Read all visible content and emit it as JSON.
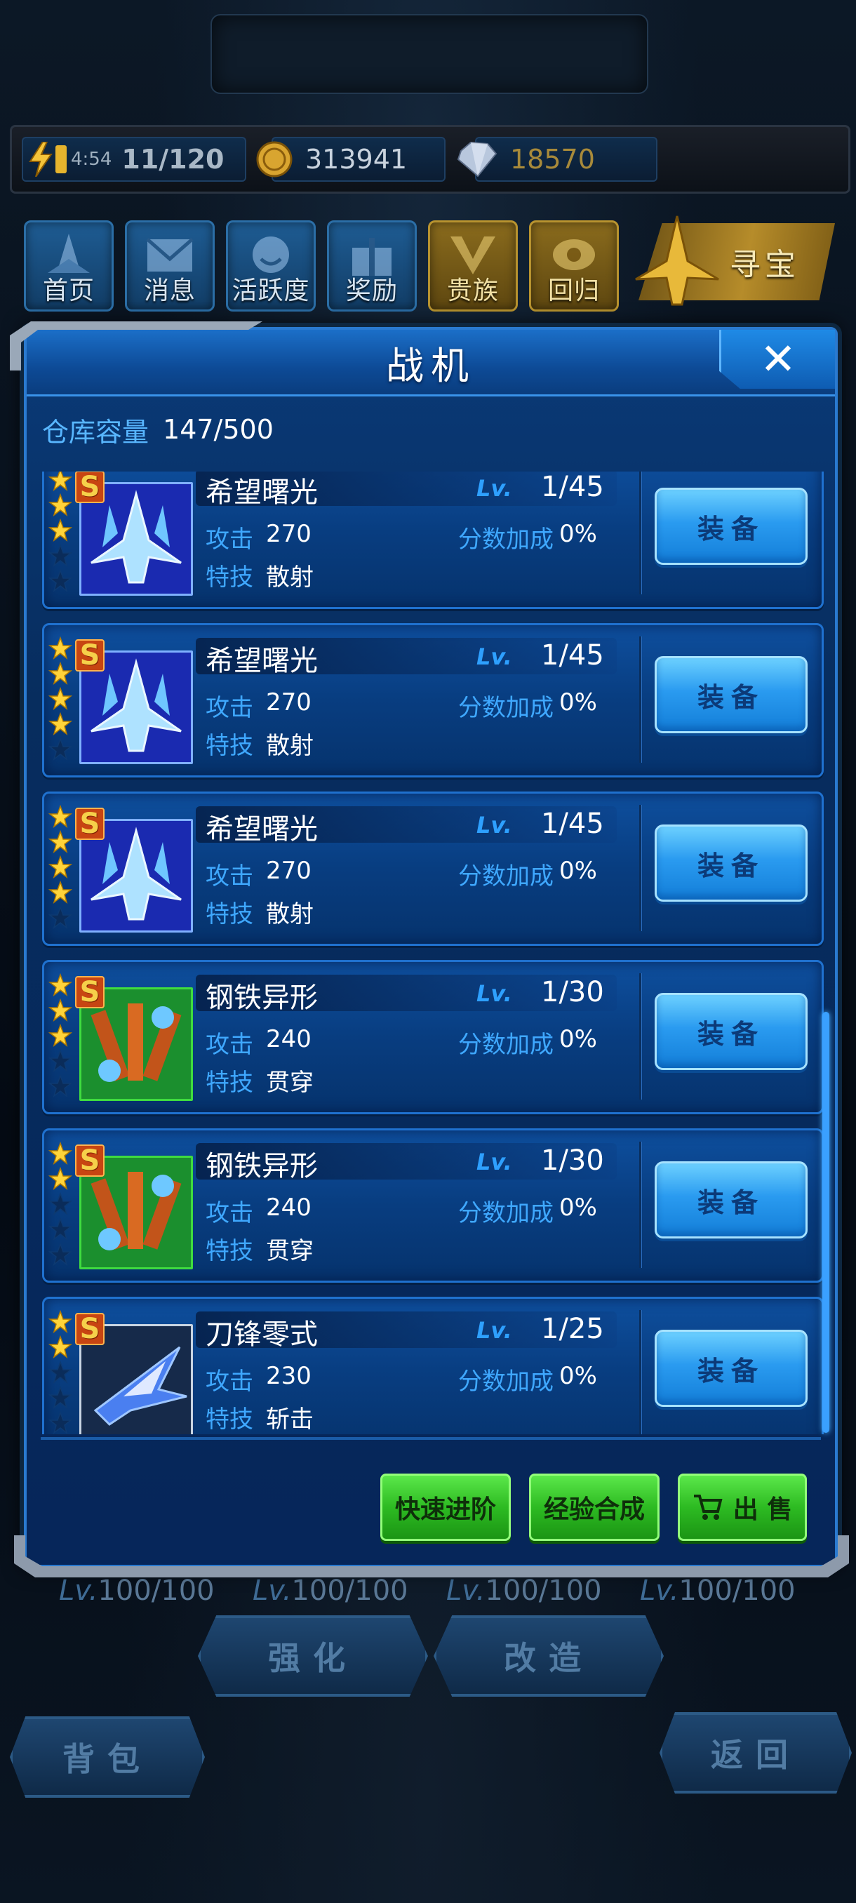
{
  "resources": {
    "energy_timer": "4:54",
    "energy": "11/120",
    "coins": "313941",
    "gems": "18570"
  },
  "nav": [
    {
      "label": "首页"
    },
    {
      "label": "消息"
    },
    {
      "label": "活跃度"
    },
    {
      "label": "奖励"
    },
    {
      "label": "贵族"
    },
    {
      "label": "回归"
    },
    {
      "label": "寻宝"
    }
  ],
  "modal": {
    "title": "战机",
    "close_symbol": "✕",
    "storage_label": "仓库容量",
    "storage_value": "147/500",
    "lv_label": "Lv.",
    "attack_label": "攻击",
    "bonus_label": "分数加成",
    "skill_label": "特技",
    "equip_label": "装备",
    "rank_badge": "S",
    "items": [
      {
        "name": "希望曙光",
        "level": "1/45",
        "attack": "270",
        "bonus": "0%",
        "skill": "散射",
        "stars": 3
      },
      {
        "name": "希望曙光",
        "level": "1/45",
        "attack": "270",
        "bonus": "0%",
        "skill": "散射",
        "stars": 4
      },
      {
        "name": "希望曙光",
        "level": "1/45",
        "attack": "270",
        "bonus": "0%",
        "skill": "散射",
        "stars": 4
      },
      {
        "name": "钢铁异形",
        "level": "1/30",
        "attack": "240",
        "bonus": "0%",
        "skill": "贯穿",
        "stars": 3
      },
      {
        "name": "钢铁异形",
        "level": "1/30",
        "attack": "240",
        "bonus": "0%",
        "skill": "贯穿",
        "stars": 2
      },
      {
        "name": "刀锋零式",
        "level": "1/25",
        "attack": "230",
        "bonus": "0%",
        "skill": "斩击",
        "stars": 2
      }
    ],
    "footer": {
      "quick_advance": "快速进阶",
      "exp_merge": "经验合成",
      "sell": "出 售"
    }
  },
  "background": {
    "levels": [
      "100/100",
      "100/100",
      "100/100",
      "100/100"
    ],
    "lv_prefix": "Lv.",
    "enhance": "强化",
    "modify": "改造",
    "backpack": "背包",
    "back": "返回"
  },
  "colors": {
    "accent_blue": "#2ea0ff",
    "button_green": "#2dbb22",
    "gold": "#f6d04a"
  }
}
